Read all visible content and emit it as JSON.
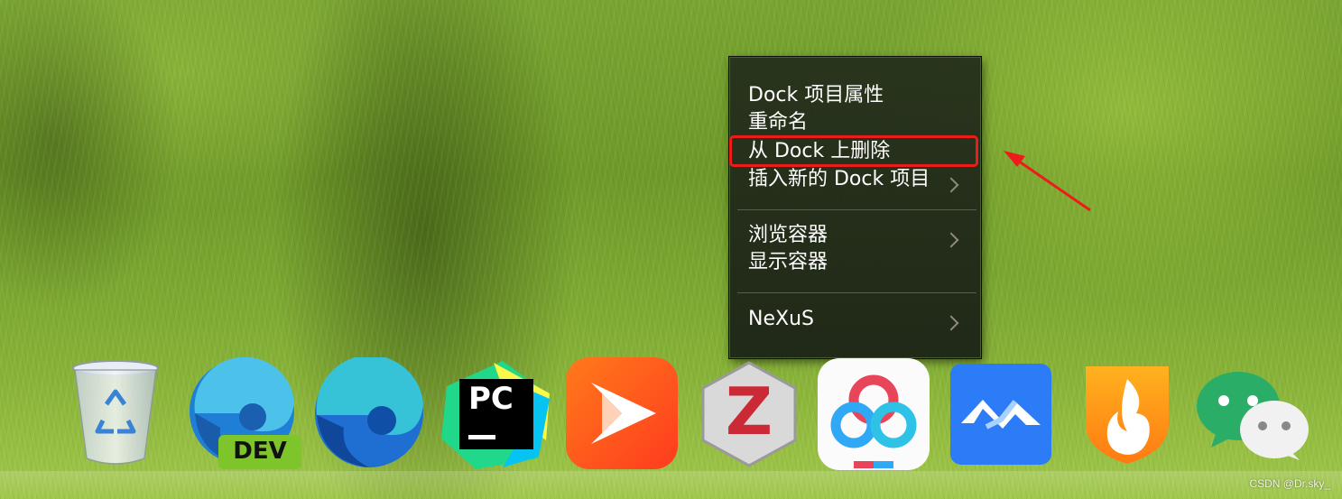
{
  "context_menu": {
    "items": [
      {
        "label": "Dock 项目属性",
        "has_submenu": false
      },
      {
        "label": "重命名",
        "has_submenu": false
      },
      {
        "label": "从 Dock 上删除",
        "has_submenu": false,
        "highlighted": true
      },
      {
        "label": "插入新的 Dock 项目",
        "has_submenu": true
      },
      {
        "label": "浏览容器",
        "has_submenu": true
      },
      {
        "label": "显示容器",
        "has_submenu": false
      },
      {
        "label": "NeXuS",
        "has_submenu": true
      }
    ]
  },
  "annotation": {
    "color": "#ee1b1b"
  },
  "dock": {
    "items": [
      {
        "name": "recycle-bin",
        "icon": "recycle-bin-icon"
      },
      {
        "name": "edge-dev",
        "icon": "edge-dev-icon",
        "badge": "DEV"
      },
      {
        "name": "edge",
        "icon": "edge-icon"
      },
      {
        "name": "pycharm",
        "icon": "pycharm-icon",
        "label": "PC"
      },
      {
        "name": "xunlei-player",
        "icon": "play-icon"
      },
      {
        "name": "zotero",
        "icon": "zotero-icon",
        "label": "Z"
      },
      {
        "name": "baidu-netdisk",
        "icon": "cloud-icon"
      },
      {
        "name": "feishu-meeting",
        "icon": "meeting-icon"
      },
      {
        "name": "huorong-security",
        "icon": "shield-flame-icon"
      },
      {
        "name": "wechat",
        "icon": "wechat-icon"
      }
    ]
  },
  "watermark": "CSDN @Dr.sky_"
}
